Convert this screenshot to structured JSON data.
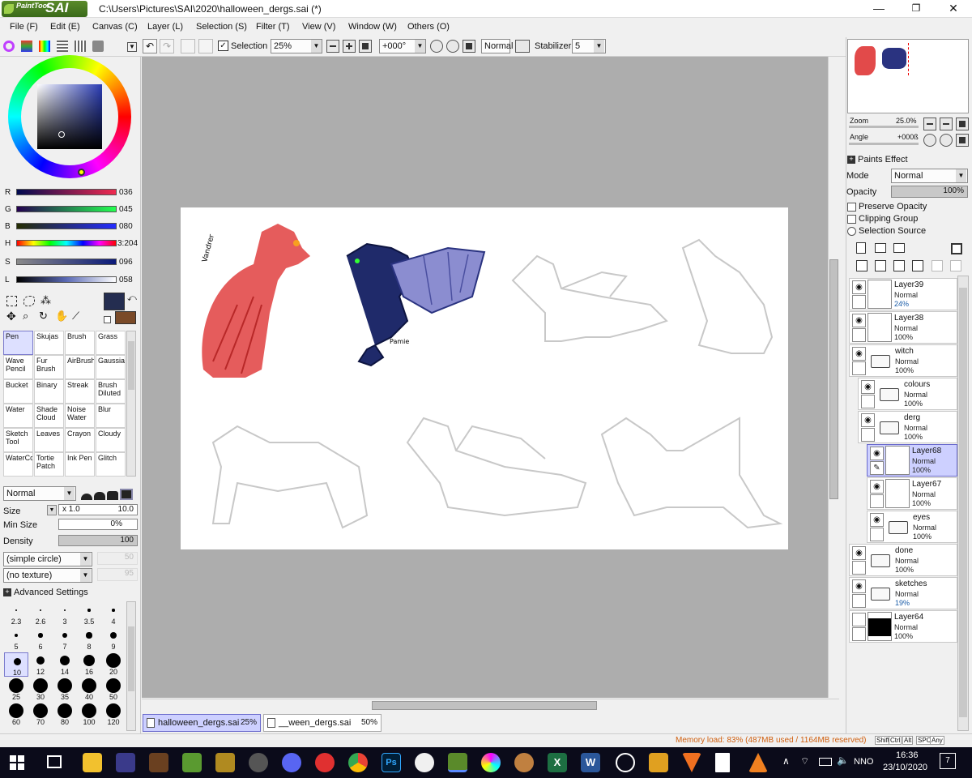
{
  "window": {
    "app_logo_small": "PaintTool",
    "app_logo_big": "SAI",
    "title": "C:\\Users\\Pictures\\SAI\\2020\\halloween_dergs.sai (*)",
    "minimize": "—",
    "maximize": "❐",
    "close": "✕"
  },
  "menu": [
    "File (F)",
    "Edit (E)",
    "Canvas (C)",
    "Layer (L)",
    "Selection (S)",
    "Filter (T)",
    "View (V)",
    "Window (W)",
    "Others (O)"
  ],
  "toolbar": {
    "selection_label": "Selection",
    "zoom": "25%",
    "angle": "+000°",
    "blend": "Normal",
    "stabilizer_label": "Stabilizer",
    "stabilizer_value": "5"
  },
  "color": {
    "r_label": "R",
    "r": "036",
    "g_label": "G",
    "g": "045",
    "b_label": "B",
    "b": "080",
    "h_label": "H",
    "h": "3:204",
    "s_label": "S",
    "s": "096",
    "l_label": "L",
    "l": "058",
    "primary": "#242d50",
    "secondary": "#7a4a28"
  },
  "tools": [
    [
      "Pen",
      "Skujas",
      "Brush",
      "Grass"
    ],
    [
      "Wave Pencil",
      "Fur Brush",
      "AirBrush",
      "Gaussian"
    ],
    [
      "Bucket",
      "Binary",
      "Streak",
      "Brush Diluted"
    ],
    [
      "Water",
      "Shade Cloud",
      "Noise Water",
      "Blur"
    ],
    [
      "Sketch Tool",
      "Leaves",
      "Crayon",
      "Cloudy"
    ],
    [
      "WaterCc",
      "Tortie Patch",
      "Ink Pen",
      "Glitch"
    ]
  ],
  "brush": {
    "mode": "Normal",
    "size_label": "Size",
    "size_mult": "x 1.0",
    "size": "10.0",
    "min_size_label": "Min Size",
    "min_size": "0%",
    "density_label": "Density",
    "density": "100",
    "shape": "(simple circle)",
    "shape_value": "50",
    "texture": "(no texture)",
    "texture_value": "95",
    "advanced_label": "Advanced Settings",
    "sizes": [
      "2.3",
      "2.6",
      "3",
      "3.5",
      "4",
      "5",
      "6",
      "7",
      "8",
      "9",
      "10",
      "12",
      "14",
      "16",
      "20",
      "25",
      "30",
      "35",
      "40",
      "50",
      "60",
      "70",
      "80",
      "100",
      "120"
    ]
  },
  "canvas": {
    "signature_1": "Vandrer",
    "signature_2": "Pamie"
  },
  "tabs": [
    {
      "name": "halloween_dergs.sai",
      "zoom": "25%"
    },
    {
      "name": "__ween_dergs.sai",
      "zoom": "50%"
    }
  ],
  "navigator": {
    "zoom_label": "Zoom",
    "zoom": "25.0%",
    "angle_label": "Angle",
    "angle": "+000ß"
  },
  "layer_panel": {
    "paints_effect": "Paints Effect",
    "mode_label": "Mode",
    "mode": "Normal",
    "opacity_label": "Opacity",
    "opacity": "100%",
    "preserve_opacity": "Preserve Opacity",
    "clipping_group": "Clipping Group",
    "selection_source": "Selection Source"
  },
  "layers": [
    {
      "name": "Layer39",
      "mode": "Normal",
      "opacity": "24%",
      "type": "layer",
      "indent": 0
    },
    {
      "name": "Layer38",
      "mode": "Normal",
      "opacity": "100%",
      "type": "layer",
      "indent": 0
    },
    {
      "name": "witch",
      "mode": "Normal",
      "opacity": "100%",
      "type": "folder",
      "indent": 0
    },
    {
      "name": "colours",
      "mode": "Normal",
      "opacity": "100%",
      "type": "folder",
      "indent": 1
    },
    {
      "name": "derg",
      "mode": "Normal",
      "opacity": "100%",
      "type": "folder",
      "indent": 1
    },
    {
      "name": "Layer68",
      "mode": "Normal",
      "opacity": "100%",
      "type": "layer",
      "indent": 2
    },
    {
      "name": "Layer67",
      "mode": "Normal",
      "opacity": "100%",
      "type": "layer",
      "indent": 2
    },
    {
      "name": "eyes",
      "mode": "Normal",
      "opacity": "100%",
      "type": "folder",
      "indent": 2
    },
    {
      "name": "done",
      "mode": "Normal",
      "opacity": "100%",
      "type": "folder",
      "indent": 0
    },
    {
      "name": "sketches",
      "mode": "Normal",
      "opacity": "19%",
      "type": "folder",
      "indent": 0
    },
    {
      "name": "Layer64",
      "mode": "Normal",
      "opacity": "100%",
      "type": "layer",
      "indent": 0
    }
  ],
  "status": {
    "memory": "Memory load: 83% (487MB used / 1164MB reserved)",
    "keys": [
      "Shift",
      "Ctrl",
      "Alt",
      "SPC",
      "Any"
    ]
  },
  "taskbar": {
    "lang": "NNO",
    "time": "16:36",
    "date": "23/10/2020",
    "notifications": "7"
  }
}
